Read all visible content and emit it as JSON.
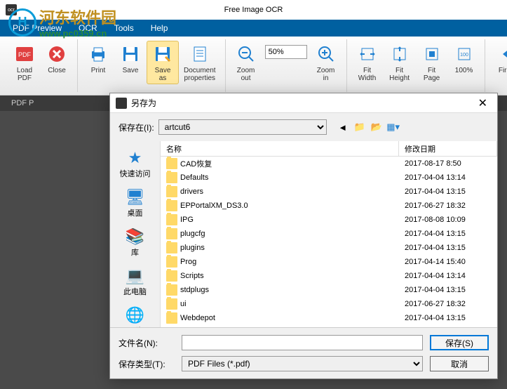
{
  "app_title": "Free Image OCR",
  "watermark": {
    "cn": "河东软件园",
    "url": "www.pc0359.cn"
  },
  "menubar": [
    "PDF Preview",
    "OCR",
    "Tools",
    "Help"
  ],
  "ribbon": {
    "load_pdf": "Load\nPDF",
    "close": "Close",
    "print": "Print",
    "save": "Save",
    "save_as": "Save\nas",
    "doc_props": "Document\nproperties",
    "zoom_out": "Zoom\nout",
    "zoom_value": "50%",
    "zoom_in": "Zoom\nin",
    "fit_width": "Fit\nWidth",
    "fit_height": "Fit\nHeight",
    "fit_page": "Fit\nPage",
    "pct100": "100%",
    "first": "First"
  },
  "tab": "PDF P",
  "dialog": {
    "title": "另存为",
    "save_in_label": "保存在(I):",
    "save_in_value": "artcut6",
    "places": [
      {
        "label": "快速访问",
        "icon": "star"
      },
      {
        "label": "桌面",
        "icon": "desktop"
      },
      {
        "label": "库",
        "icon": "library"
      },
      {
        "label": "此电脑",
        "icon": "computer"
      },
      {
        "label": "网络",
        "icon": "network"
      }
    ],
    "columns": {
      "name": "名称",
      "date": "修改日期"
    },
    "files": [
      {
        "name": "CAD恢复",
        "date": "2017-08-17 8:50"
      },
      {
        "name": "Defaults",
        "date": "2017-04-04 13:14"
      },
      {
        "name": "drivers",
        "date": "2017-04-04 13:15"
      },
      {
        "name": "EPPortalXM_DS3.0",
        "date": "2017-06-27 18:32"
      },
      {
        "name": "IPG",
        "date": "2017-08-08 10:09"
      },
      {
        "name": "plugcfg",
        "date": "2017-04-04 13:15"
      },
      {
        "name": "plugins",
        "date": "2017-04-04 13:15"
      },
      {
        "name": "Prog",
        "date": "2017-04-14 15:40"
      },
      {
        "name": "Scripts",
        "date": "2017-04-04 13:14"
      },
      {
        "name": "stdplugs",
        "date": "2017-04-04 13:15"
      },
      {
        "name": "ui",
        "date": "2017-06-27 18:32"
      },
      {
        "name": "Webdepot",
        "date": "2017-04-04 13:15"
      }
    ],
    "filename_label": "文件名(N):",
    "filename_value": "",
    "filetype_label": "保存类型(T):",
    "filetype_value": "PDF Files (*.pdf)",
    "save_btn": "保存(S)",
    "cancel_btn": "取消"
  }
}
